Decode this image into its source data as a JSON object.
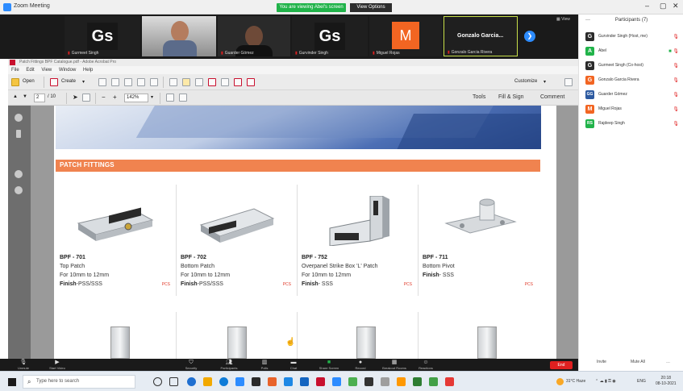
{
  "zoom": {
    "window_title": "Zoom Meeting",
    "share_banner": "You are viewing Abel's screen",
    "view_options": "View Options",
    "view_button": "View",
    "participant_tiles": [
      {
        "name": "Gurmeet Singh",
        "type": "logo",
        "logo_text": "Gs"
      },
      {
        "name": "",
        "type": "video"
      },
      {
        "name": "Guarder Gómez",
        "type": "video"
      },
      {
        "name": "Gurvinder Singh",
        "type": "logo",
        "logo_text": "Gs"
      },
      {
        "name": "Miguel Rojas",
        "type": "avatar",
        "initial": "M"
      },
      {
        "name": "Gonzalo Garcia Rivera",
        "type": "name",
        "big_name": "Gonzalo Garcia..."
      }
    ]
  },
  "participants_panel": {
    "title": "Participants (7)",
    "items": [
      {
        "initial": "G",
        "name": "Gurvinder Singh (Host, me)",
        "color": "#2b2b2b"
      },
      {
        "initial": "A",
        "name": "Abel",
        "color": "#21b34a"
      },
      {
        "initial": "G",
        "name": "Gurmeet Singh (Co-host)",
        "color": "#2b2b2b"
      },
      {
        "initial": "G",
        "name": "Gonzalo Garcia Rivera",
        "color": "#f26522"
      },
      {
        "initial": "GG",
        "name": "Guarder Gómez",
        "color": "#2d5aa0"
      },
      {
        "initial": "M",
        "name": "Miguel Rojas",
        "color": "#f26522"
      },
      {
        "initial": "RS",
        "name": "Rajdeep Singh",
        "color": "#21b34a"
      }
    ],
    "invite": "Invite",
    "mute_all": "Mute All"
  },
  "acrobat": {
    "title": "Patch Fittings BPF Catalogue.pdf - Adobe Acrobat Pro",
    "menu": [
      "File",
      "Edit",
      "View",
      "Window",
      "Help"
    ],
    "open": "Open",
    "create": "Create",
    "customize": "Customize",
    "page_current": "2",
    "page_total": "/ 10",
    "zoom": "142%",
    "tools": "Tools",
    "fill_sign": "Fill & Sign",
    "comment": "Comment"
  },
  "document": {
    "section_title": "PATCH FITTINGS",
    "products": [
      {
        "code": "BPF - 701",
        "name": "Top Patch",
        "spec": "For 10mm to 12mm",
        "finish_label": "Finish",
        "finish_value": "-PSS/SSS",
        "unit": "PCS"
      },
      {
        "code": "BPF - 702",
        "name": "Bottom Patch",
        "spec": "For 10mm to 12mm",
        "finish_label": "Finish",
        "finish_value": "-PSS/SSS",
        "unit": "PCS"
      },
      {
        "code": "BPF - 752",
        "name": "Overpanel Strike Box 'L' Patch",
        "spec": "For 10mm to 12mm",
        "finish_label": "Finish",
        "finish_value": "- SSS",
        "unit": "PCS"
      },
      {
        "code": "BPF - 711",
        "name": "Bottom Pivot",
        "spec": "",
        "finish_label": "Finish",
        "finish_value": "- SSS",
        "unit": "PCS"
      }
    ]
  },
  "zoom_controls": [
    {
      "label": "Unmute",
      "icon": "mic-icon"
    },
    {
      "label": "Start Video",
      "icon": "video-icon"
    },
    {
      "label": "Security",
      "icon": "shield-icon"
    },
    {
      "label": "Participants",
      "icon": "participants-icon"
    },
    {
      "label": "Polls",
      "icon": "polls-icon"
    },
    {
      "label": "Chat",
      "icon": "chat-icon"
    },
    {
      "label": "Share Screen",
      "icon": "share-icon"
    },
    {
      "label": "Record",
      "icon": "record-icon"
    },
    {
      "label": "Breakout Rooms",
      "icon": "breakout-icon"
    },
    {
      "label": "Reactions",
      "icon": "reactions-icon"
    }
  ],
  "end_button": "End",
  "taskbar": {
    "search_placeholder": "Type here to search",
    "weather": "31°C Haze",
    "lang": "ENG",
    "time": "20:18",
    "date": "08-10-2021"
  }
}
